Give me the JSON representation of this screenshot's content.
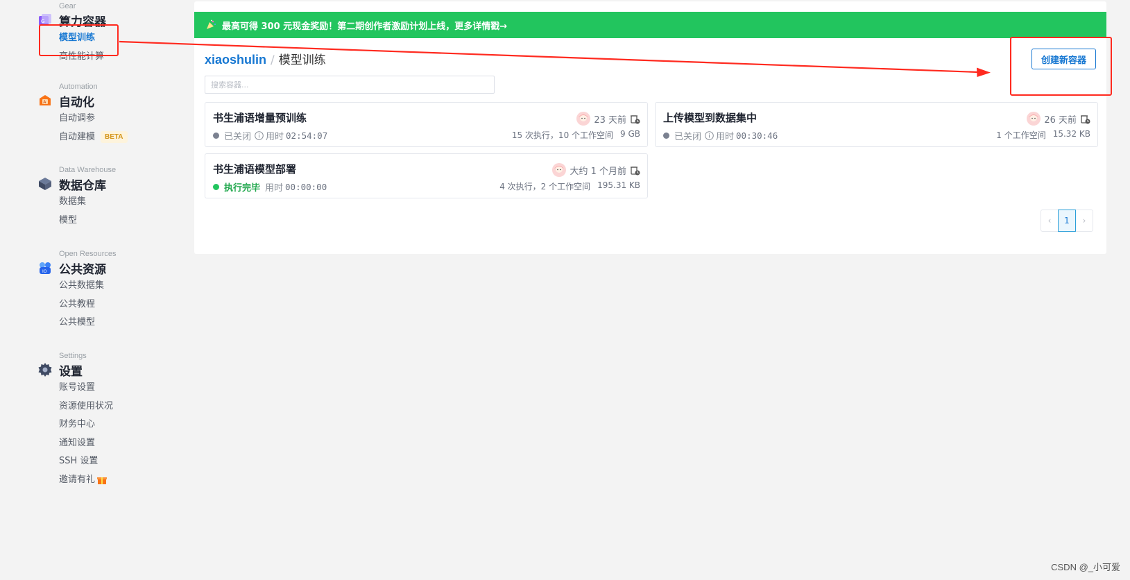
{
  "sidebar": {
    "sections": [
      {
        "eyebrow": "Gear",
        "title": "算力容器",
        "icon": "gear-container-icon",
        "items": [
          {
            "label": "模型训练",
            "active": true
          },
          {
            "label": "高性能计算"
          }
        ]
      },
      {
        "eyebrow": "Automation",
        "title": "自动化",
        "icon": "automation-icon",
        "items": [
          {
            "label": "自动调参"
          },
          {
            "label": "自动建模",
            "badge": "BETA"
          }
        ]
      },
      {
        "eyebrow": "Data Warehouse",
        "title": "数据仓库",
        "icon": "data-warehouse-icon",
        "items": [
          {
            "label": "数据集"
          },
          {
            "label": "模型"
          }
        ]
      },
      {
        "eyebrow": "Open Resources",
        "title": "公共资源",
        "icon": "open-resources-icon",
        "items": [
          {
            "label": "公共数据集"
          },
          {
            "label": "公共教程"
          },
          {
            "label": "公共模型"
          }
        ]
      },
      {
        "eyebrow": "Settings",
        "title": "设置",
        "icon": "settings-gear-icon",
        "items": [
          {
            "label": "账号设置"
          },
          {
            "label": "资源使用状况"
          },
          {
            "label": "财务中心"
          },
          {
            "label": "通知设置"
          },
          {
            "label": "SSH 设置"
          },
          {
            "label": "邀请有礼",
            "icon": "gift-icon"
          }
        ]
      }
    ]
  },
  "banner": {
    "text": "最高可得 300 元现金奖励！第二期创作者激励计划上线，更多详情戳→",
    "icon": "party-popper-icon",
    "color": "#22c55e"
  },
  "breadcrumb": {
    "user": "xiaoshulin",
    "separator": "/",
    "page": "模型训练"
  },
  "create_button": {
    "label": "创建新容器"
  },
  "search": {
    "placeholder": "搜索容器...",
    "value": ""
  },
  "containers": [
    {
      "title": "书生浦语增量预训练",
      "time_ago": "23 天前",
      "status": "已关闭",
      "status_type": "closed",
      "duration_label": "用时",
      "duration": "02:54:07",
      "runs": "15 次执行，10 个工作空间",
      "size": "9 GB"
    },
    {
      "title": "上传模型到数据集中",
      "time_ago": "26 天前",
      "status": "已关闭",
      "status_type": "closed",
      "duration_label": "用时",
      "duration": "00:30:46",
      "runs": "1 个工作空间",
      "size": "15.32 KB"
    },
    {
      "title": "书生浦语模型部署",
      "time_ago": "大约 1 个月前",
      "status": "执行完毕",
      "status_type": "done",
      "duration_label": "用时",
      "duration": "00:00:00",
      "runs": "4 次执行，2 个工作空间",
      "size": "195.31 KB"
    }
  ],
  "pagination": {
    "prev": "‹",
    "current": "1",
    "next": "›"
  },
  "watermark": "CSDN @_小可爱",
  "colors": {
    "accent": "#1677d2",
    "success": "#22c55e",
    "annotation": "#ff2a1f"
  }
}
